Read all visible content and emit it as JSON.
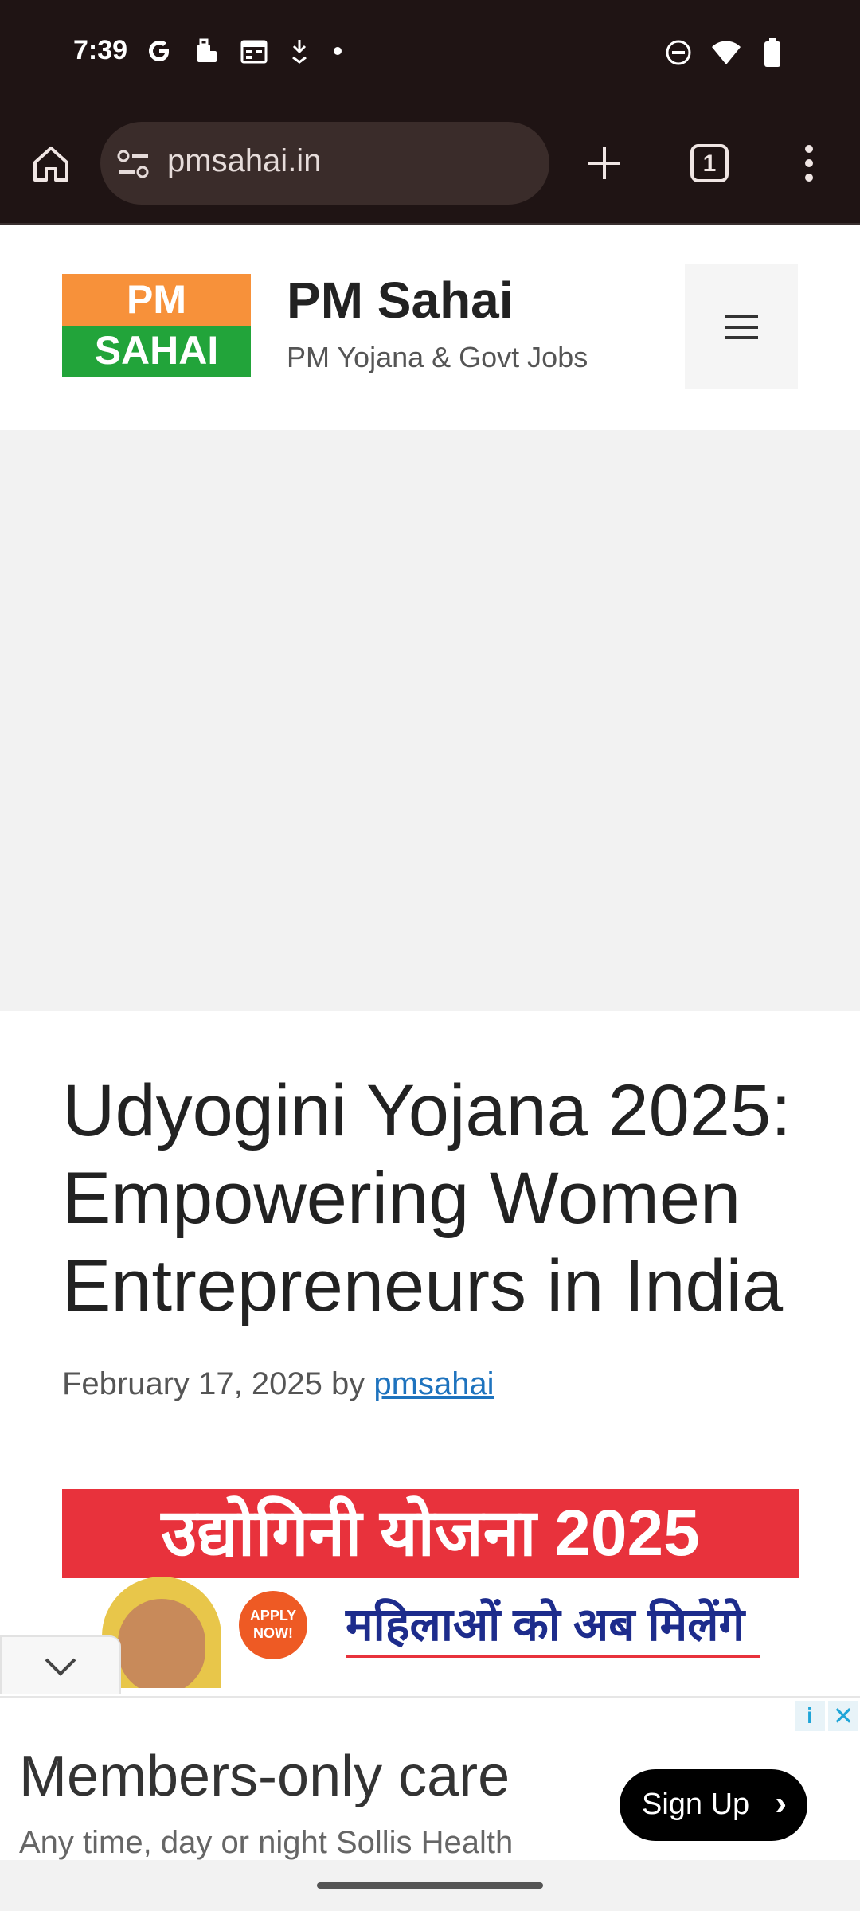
{
  "status_bar": {
    "time": "7:39",
    "left_icons": [
      "google-icon",
      "work-briefcase-icon",
      "calendar-icon",
      "download-icon",
      "dot-icon"
    ],
    "right_icons": [
      "do-not-disturb-icon",
      "wifi-icon",
      "battery-icon"
    ]
  },
  "browser": {
    "url": "pmsahai.in",
    "tab_count": "1"
  },
  "site": {
    "logo_top": "PM",
    "logo_bottom": "SAHAI",
    "title": "PM Sahai",
    "description": "PM Yojana & Govt Jobs"
  },
  "article": {
    "title": "Udyogini Yojana 2025: Empowering Women Entrepreneurs in India",
    "date": "February 17, 2025",
    "by": "by",
    "author": "pmsahai",
    "banner_heading": "उद्योगिनी योजना 2025",
    "banner_sub": "महिलाओं को अब मिलेंगे",
    "banner_badge": "APPLY NOW!"
  },
  "ad": {
    "headline": "Members-only care",
    "body": "Any time, day or night Sollis Health",
    "button": "Sign Up",
    "info_glyph": "i",
    "close_glyph": "✕"
  },
  "colors": {
    "chrome_bg": "#1f1414",
    "link": "#1e73be",
    "banner_red": "#e8323c",
    "logo_orange": "#f7913a",
    "logo_green": "#22a43a"
  }
}
